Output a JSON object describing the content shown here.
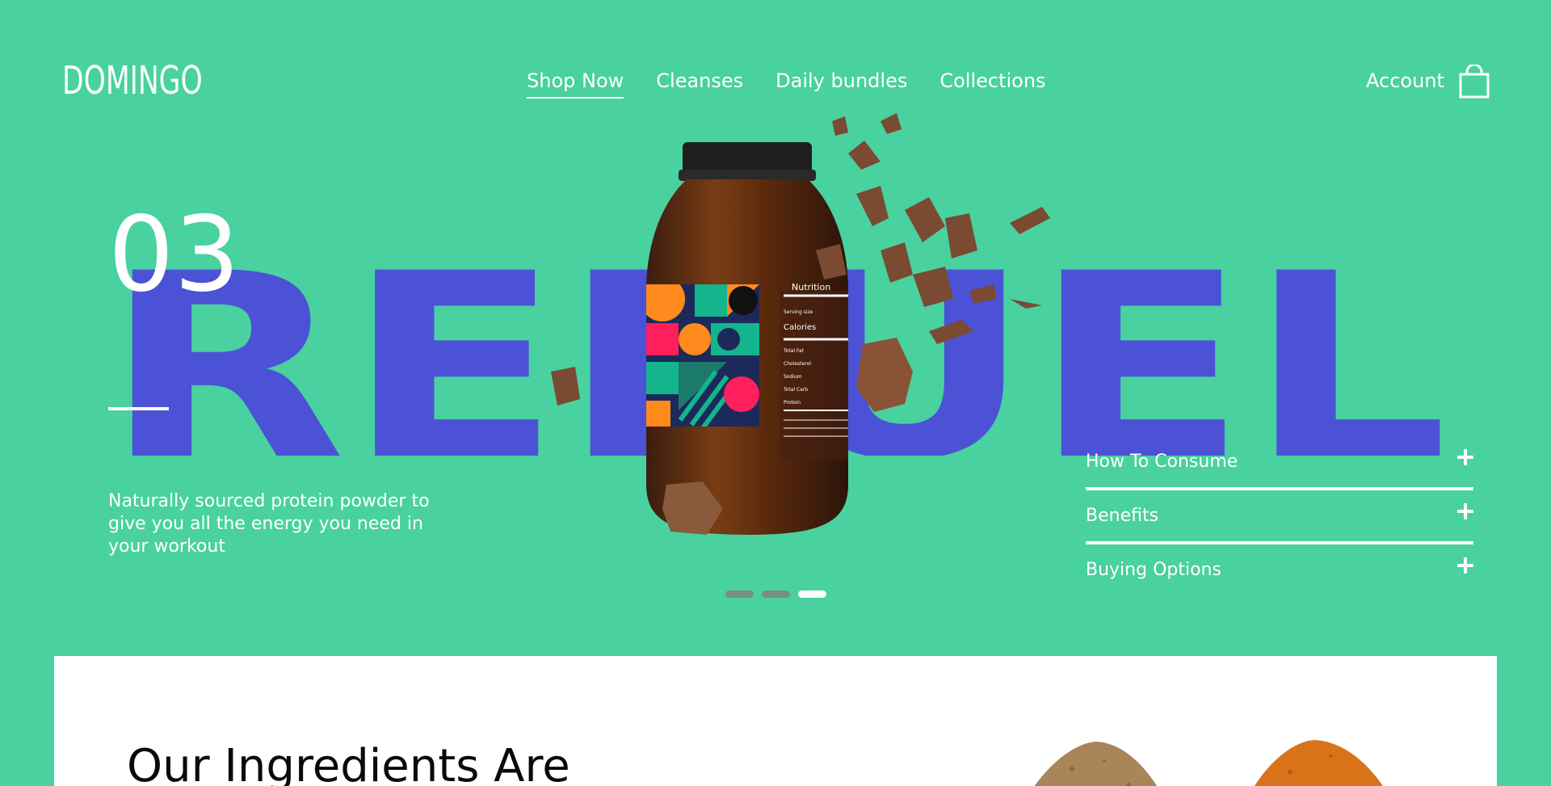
{
  "brand": {
    "logo": "DOMINGO"
  },
  "nav": {
    "items": [
      {
        "label": "Shop Now",
        "active": true
      },
      {
        "label": "Cleanses",
        "active": false
      },
      {
        "label": "Daily bundles",
        "active": false
      },
      {
        "label": "Collections",
        "active": false
      }
    ],
    "account_label": "Account",
    "cart_icon": "shopping-bag-icon"
  },
  "hero": {
    "number": "03",
    "headline": "REFUEL",
    "description": "Naturally sourced protein powder to give you all the energy you need in your workout",
    "product_image": "protein-jar-with-chocolate-pieces",
    "label_text": "Nutrition",
    "label_lines": [
      "Serving size",
      "Calories",
      "Total Fat",
      "Cholesterol",
      "Sodium",
      "Total Carb",
      "Protein"
    ]
  },
  "accordion": {
    "items": [
      {
        "label": "How To Consume",
        "icon": "plus-icon"
      },
      {
        "label": "Benefits",
        "icon": "plus-icon"
      },
      {
        "label": "Buying Options",
        "icon": "plus-icon"
      }
    ]
  },
  "slider": {
    "total": 3,
    "active_index": 3
  },
  "ingredients": {
    "title": "Our Ingredients Are"
  },
  "colors": {
    "background": "#49d19f",
    "headline": "#4b52d6",
    "text": "#ffffff",
    "panel": "#ffffff",
    "dot_inactive": "#7a8d85"
  }
}
